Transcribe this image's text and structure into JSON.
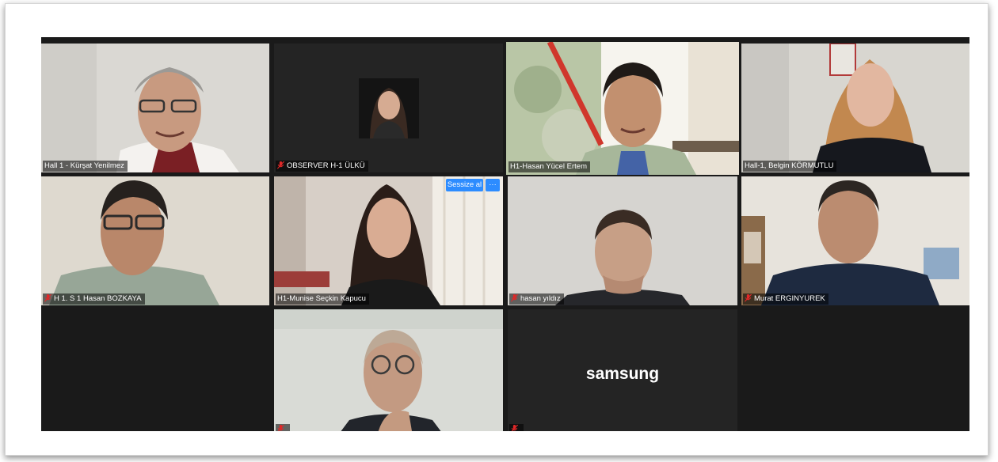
{
  "participants": [
    {
      "name": "Hall 1 - Kürşat Yenilmez",
      "muted": false
    },
    {
      "name": "OBSERVER H-1 ÜLKÜ",
      "muted": true,
      "video": false
    },
    {
      "name": "H1-Hasan Yücel Ertem",
      "muted": false,
      "active_speaker": true
    },
    {
      "name": "Hall-1, Belgin KÖRMUTLU",
      "muted": false
    },
    {
      "name": "H 1. S 1 Hasan BOZKAYA",
      "muted": true
    },
    {
      "name": "H1-Munise Seçkin Kapucu",
      "muted": false
    },
    {
      "name": "hasan yıldız",
      "muted": true
    },
    {
      "name": "Murat ERGINYUREK",
      "muted": true
    },
    {
      "name": "",
      "muted": true
    },
    {
      "name": "",
      "muted": true,
      "video": false
    }
  ],
  "tile_menu": {
    "mute_label": "Sessize al",
    "more_label": "···"
  },
  "device_label": "samsung",
  "colors": {
    "active_speaker_border": "#c6e85a",
    "button_blue": "#2d8cff",
    "muted_red": "#e02828"
  }
}
